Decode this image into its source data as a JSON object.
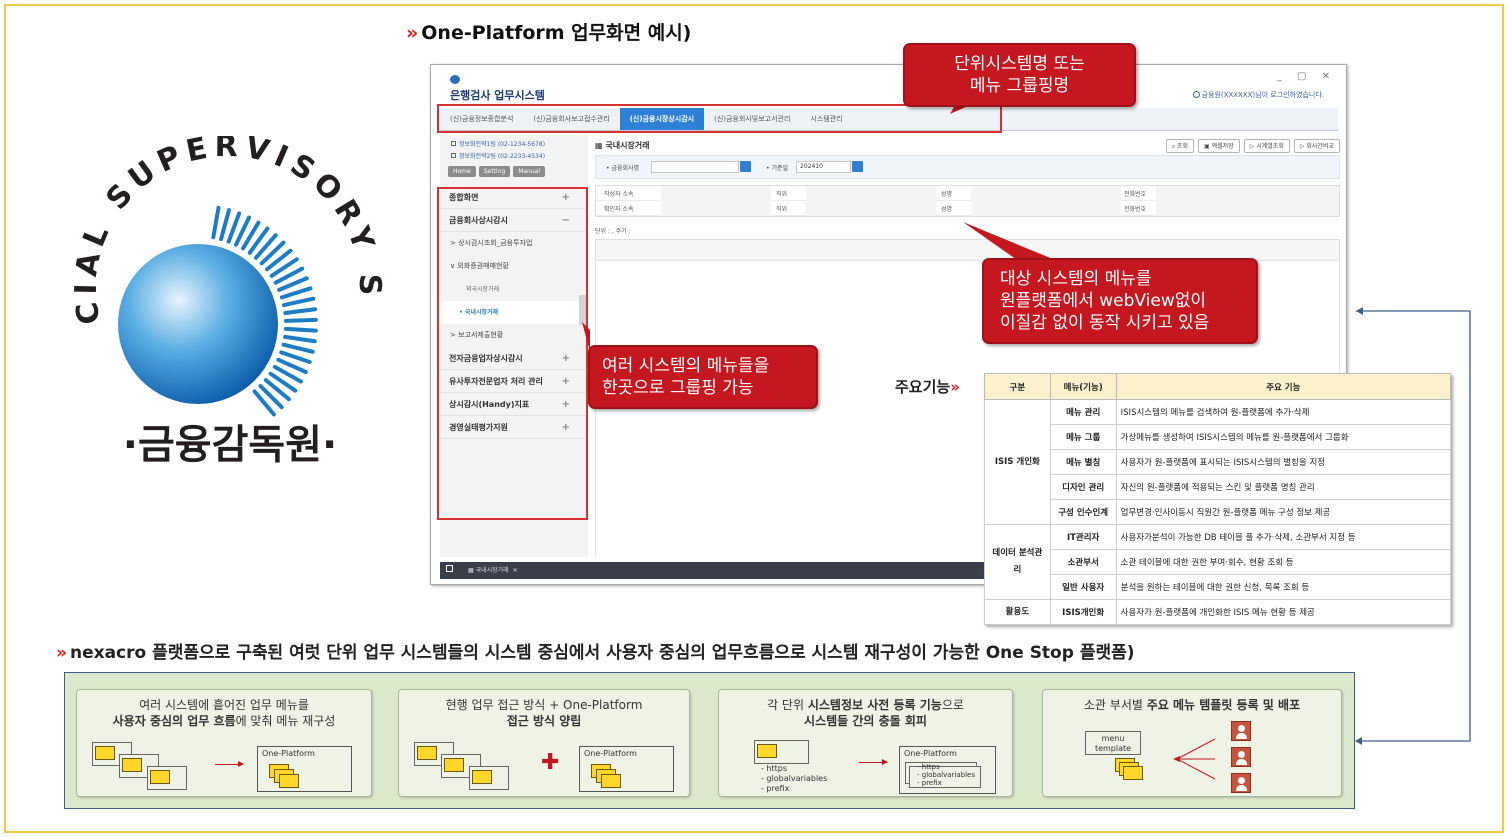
{
  "header": {
    "mark": "»",
    "title": "One-Platform 업무화면 예시)"
  },
  "logo": {
    "arc_text": "FINANCIAL SUPERVISORY SERVICE",
    "korean_name": "·금융감독원·",
    "colors": {
      "blue": "#1c7dc6",
      "dark": "#231f20"
    }
  },
  "app": {
    "title": "은행검사 업무시스템",
    "login_text": "금융원(XXXXXX)님이 로그인하였습니다.",
    "tabs": [
      "(신)금융정보종합분석",
      "(신)금융회사보고접수관리",
      "(신)금융시장상시감시",
      "(신)금융회사및보고서관리",
      "시스템관리"
    ],
    "active_tab": 2,
    "phones": [
      "정보화전략1팀 (02-1234-5678)",
      "정보화전략2팀 (02-2233-4534)"
    ],
    "side_buttons": [
      "Home",
      "Setting",
      "Manual"
    ],
    "menu": [
      {
        "label": "종합화면",
        "kind": "top",
        "toggle": "+"
      },
      {
        "label": "금융회사상시감시",
        "kind": "top",
        "toggle": "−"
      },
      {
        "label": "> 상시감시조회_금융투자업",
        "kind": "sub"
      },
      {
        "label": "∨ 외화증권매매현황",
        "kind": "sub"
      },
      {
        "label": "외국시장거래",
        "kind": "sub2"
      },
      {
        "label": "• 국내시장거래",
        "kind": "sel"
      },
      {
        "label": "> 보고서제출현황",
        "kind": "sub"
      },
      {
        "label": "전자금융업자상시감시",
        "kind": "top",
        "toggle": "+"
      },
      {
        "label": "유사투자전문업자 처리 관리",
        "kind": "top",
        "toggle": "+"
      },
      {
        "label": "상시감시(Handy)지표",
        "kind": "top",
        "toggle": "+"
      },
      {
        "label": "경영실태평가지원",
        "kind": "top",
        "toggle": "+"
      }
    ],
    "page_title": "국내시장거래",
    "actions": [
      "조회",
      "엑셀저장",
      "시계열조회",
      "회사간비교"
    ],
    "search": {
      "company_label": "• 금융회사명",
      "date_label": "• 기준일",
      "date_value": "202410"
    },
    "grid_rows": [
      [
        "작성자 소속",
        "직위",
        "성명",
        "전화번호"
      ],
      [
        "확인자 소속",
        "직위",
        "성명",
        "전화번호"
      ]
    ],
    "unit_text": "단위 : , 주기 :",
    "bottom_tab": "국내시장거래"
  },
  "callouts": {
    "top": [
      "단위시스템명 또는",
      "메뉴 그룹핑명"
    ],
    "right": [
      "대상 시스템의 메뉴를",
      "원플랫폼에서 webView없이",
      "이질감 없이 동작 시키고 있음"
    ],
    "left": [
      "여러 시스템의 메뉴들을",
      "한곳으로 그룹핑 가능"
    ]
  },
  "functions": {
    "label": "주요기능",
    "mark": "»",
    "headers": [
      "구분",
      "메뉴(기능)",
      "주요 기능"
    ],
    "groups": [
      {
        "name": "ISIS 개인화",
        "rows": [
          [
            "메뉴 관리",
            "ISIS시스템의 메뉴를 검색하여 원-플랫폼에 추가·삭제"
          ],
          [
            "메뉴 그룹",
            "가상메뉴를 생성하여 ISIS시스템의 메뉴를 원-플랫폼에서 그룹화"
          ],
          [
            "메뉴 별칭",
            "사용자가 원-플랫폼에 표시되는 ISIS시스템의 별칭을 지정"
          ],
          [
            "디자인 관리",
            "자신의 원-플랫폼에 적용되는 스킨 및 플랫폼 명칭 관리"
          ],
          [
            "구성 인수인계",
            "업무변경·인사이동시 직원간 원-플랫폼 메뉴 구성 정보 제공"
          ]
        ]
      },
      {
        "name": "데이터 분석관리",
        "rows": [
          [
            "IT관리자",
            "사용자가분석이 가능한 DB 테이블 풀 추가·삭제, 소관부서 지정 등"
          ],
          [
            "소관부서",
            "소관 테이블에 대한 권한 부여·회수, 현황 조회 등"
          ],
          [
            "일반 사용자",
            "분석을 원하는 테이블에 대한 권한 신청, 목록 조회 등"
          ]
        ]
      },
      {
        "name": "활용도",
        "rows": [
          [
            "ISIS개인화",
            "사용자가 원-플랫폼에 개인화한 ISIS 메뉴 현황 등 제공"
          ]
        ]
      }
    ]
  },
  "summary": {
    "mark": "»",
    "text": "nexacro 플랫폼으로 구축된 여럿 단위 업무 시스템들의 시스템 중심에서 사용자 중심의 업무흐름으로 시스템 재구성이 가능한 One Stop 플랫폼)"
  },
  "cards": [
    {
      "line1": "여러 시스템에 흩어진 업무 메뉴를",
      "line2a": "사용자 중심의 업무 흐름",
      "line2b": "에 맞춰 메뉴 재구성",
      "box_label": "One-Platform"
    },
    {
      "line1": "현행 업무 접근 방식 + One-Platform",
      "line2a": "접근 방식 양립",
      "line2b": "",
      "box_label": "One-Platform"
    },
    {
      "line1a": "각 단위 ",
      "line1b": "시스템정보 사전 등록 기능",
      "line1c": "으로",
      "line2": "시스템들 간의 충돌 회피",
      "list": [
        "- https",
        "- globalvariables",
        "- prefix"
      ],
      "box_label": "One-Platform",
      "inner_list": [
        "- https",
        "- globalvariables",
        "- prefix"
      ]
    },
    {
      "line1a": "소관 부서별 ",
      "line1b": "주요 메뉴 템플릿 등록 및 배포",
      "template_label": "menu template"
    }
  ],
  "colors": {
    "accent_red": "#c4171f",
    "tab_blue": "#2e7fd6",
    "panel_green": "#dce8cc",
    "frame_yellow": "#f1c84a"
  }
}
